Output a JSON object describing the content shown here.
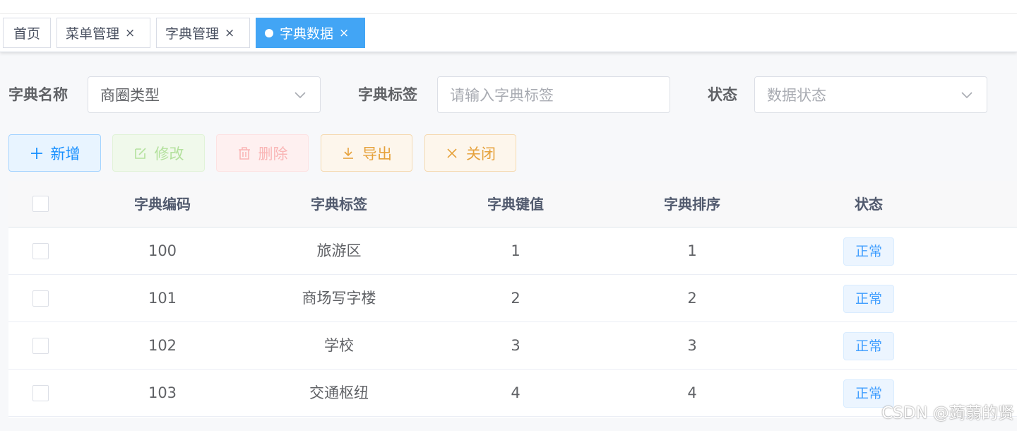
{
  "tabs": [
    {
      "label": "首页",
      "closable": false,
      "active": false
    },
    {
      "label": "菜单管理",
      "closable": true,
      "active": false
    },
    {
      "label": "字典管理",
      "closable": true,
      "active": false
    },
    {
      "label": "字典数据",
      "closable": true,
      "active": true
    }
  ],
  "close_glyph": "×",
  "filters": {
    "dict_name_label": "字典名称",
    "dict_name_value": "商圈类型",
    "dict_tag_label": "字典标签",
    "dict_tag_placeholder": "请输入字典标签",
    "status_label": "状态",
    "status_placeholder": "数据状态"
  },
  "toolbar": {
    "add": "新增",
    "edit": "修改",
    "delete": "删除",
    "export": "导出",
    "close": "关闭"
  },
  "table": {
    "columns": [
      "字典编码",
      "字典标签",
      "字典键值",
      "字典排序",
      "状态"
    ],
    "rows": [
      {
        "code": "100",
        "label": "旅游区",
        "value": "1",
        "sort": "1",
        "status": "正常"
      },
      {
        "code": "101",
        "label": "商场写字楼",
        "value": "2",
        "sort": "2",
        "status": "正常"
      },
      {
        "code": "102",
        "label": "学校",
        "value": "3",
        "sort": "3",
        "status": "正常"
      },
      {
        "code": "103",
        "label": "交通枢纽",
        "value": "4",
        "sort": "4",
        "status": "正常"
      }
    ]
  },
  "watermark": "CSDN @蒟蒻的贤",
  "colors": {
    "primary": "#409eff",
    "active_tab": "#42a5f5",
    "success_light": "#b3e19d",
    "danger_light": "#fab6b6",
    "warning": "#e6a23c"
  }
}
